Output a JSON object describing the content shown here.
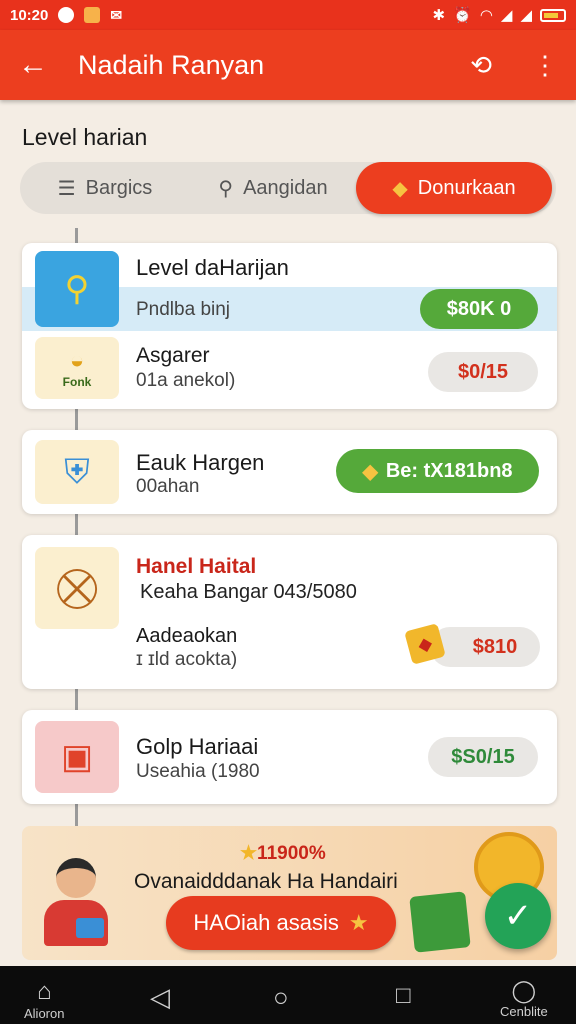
{
  "status_bar": {
    "time": "10:20",
    "icons": [
      "whatsapp-icon",
      "gear-icon",
      "mail-icon",
      "bluetooth-icon",
      "alarm-icon",
      "wifi-icon",
      "signal-icon",
      "battery-icon"
    ]
  },
  "app_bar": {
    "title": "Nadaih Ranyan",
    "back_icon": "arrow-left-icon",
    "profile_icon": "swap-user-icon",
    "menu_icon": "more-vertical-icon"
  },
  "section_title": "Level harian",
  "tabs": [
    {
      "label": "Bargics",
      "icon": "list-icon"
    },
    {
      "label": "Aangidan",
      "icon": "person-search-icon"
    },
    {
      "label": "Donurkaan",
      "icon": "tag-icon",
      "active": true
    }
  ],
  "cards": {
    "card1": {
      "title": "Level daHarijan",
      "highlight_text": "Pndlba binj",
      "highlight_button": "$80K 0",
      "item_title": "Asgarer",
      "item_sub": "01a anekol)",
      "item_price": "$0/15",
      "item_badge": "Fonk"
    },
    "card2": {
      "title": "Eauk Hargen",
      "sub": "00ahan",
      "button": "Be: tX181bn8"
    },
    "card3": {
      "title": "Hanel Haital",
      "sub": "Keaha Bangar 043/5080",
      "item_title": "Aadeaokan",
      "item_sub": "ɪ ɪld acokta)",
      "price": "$810"
    },
    "card4": {
      "title": "Golp Hariaai",
      "sub": "Useahia (1980",
      "price": "$S0/15"
    }
  },
  "banner": {
    "badge": "11900%",
    "text": "Ovanaidddanak Ha Handairi",
    "button": "HAOiah asasis"
  },
  "nav": {
    "left_label": "Alioron",
    "right_label": "Cenblite"
  },
  "colors": {
    "primary": "#ec3e1f",
    "green": "#55a93a",
    "price_red": "#d2311d",
    "price_green": "#2f8a3a"
  }
}
